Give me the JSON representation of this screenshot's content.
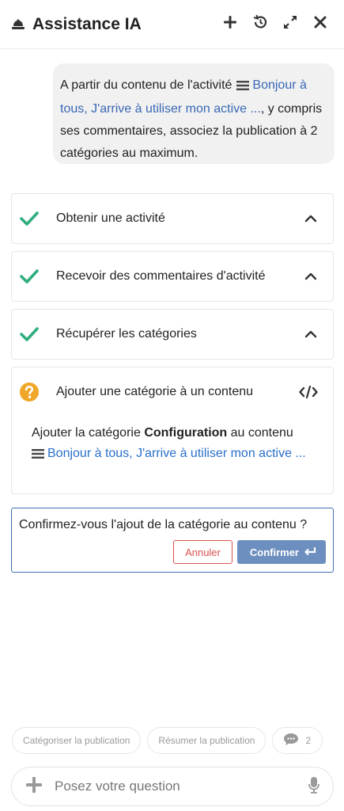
{
  "header": {
    "title": "Assistance IA",
    "title_icon": "bell-icon",
    "actions": [
      "plus-icon",
      "history-icon",
      "expand-icon",
      "close-icon"
    ]
  },
  "user_message": {
    "text_before": "A partir du contenu de l'activité",
    "link_icon": "lines-icon",
    "link_text": "Bonjour à tous, J'arrive à utiliser mon active ...",
    "text_after": ", y compris ses commentaires, associez la publication à 2 catégories au maximum."
  },
  "steps": [
    {
      "status": "done",
      "status_icon": "check-icon",
      "label": "Obtenir une activité",
      "toggle_icon": "chevron-up-icon"
    },
    {
      "status": "done",
      "status_icon": "check-icon",
      "label": "Recevoir des commentaires d'activité",
      "toggle_icon": "chevron-up-icon"
    },
    {
      "status": "done",
      "status_icon": "check-icon",
      "label": "Récupérer les catégories",
      "toggle_icon": "chevron-up-icon"
    },
    {
      "status": "pending",
      "status_icon": "question-icon",
      "label": "Ajouter une catégorie à un contenu",
      "toggle_icon": "code-icon",
      "detail": {
        "prefix": "Ajouter la catégorie",
        "category": "Configuration",
        "middle": "au contenu",
        "link_text": "Bonjour à tous, J'arrive à utiliser mon active ..."
      }
    }
  ],
  "confirm": {
    "question": "Confirmez-vous l'ajout de la catégorie au contenu ?",
    "cancel_label": "Annuler",
    "confirm_label": "Confirmer"
  },
  "suggestions": {
    "chips": [
      "Catégoriser la publication",
      "Résumer la publication"
    ],
    "comments_count": "2"
  },
  "input": {
    "placeholder": "Posez votre question",
    "value": ""
  },
  "colors": {
    "check": "#2fae7d",
    "question": "#f0a629",
    "link": "#3a68b4",
    "confirm_border": "#3f6fb0",
    "confirm_button": "#6d8fbf",
    "cancel": "#d9534f"
  }
}
